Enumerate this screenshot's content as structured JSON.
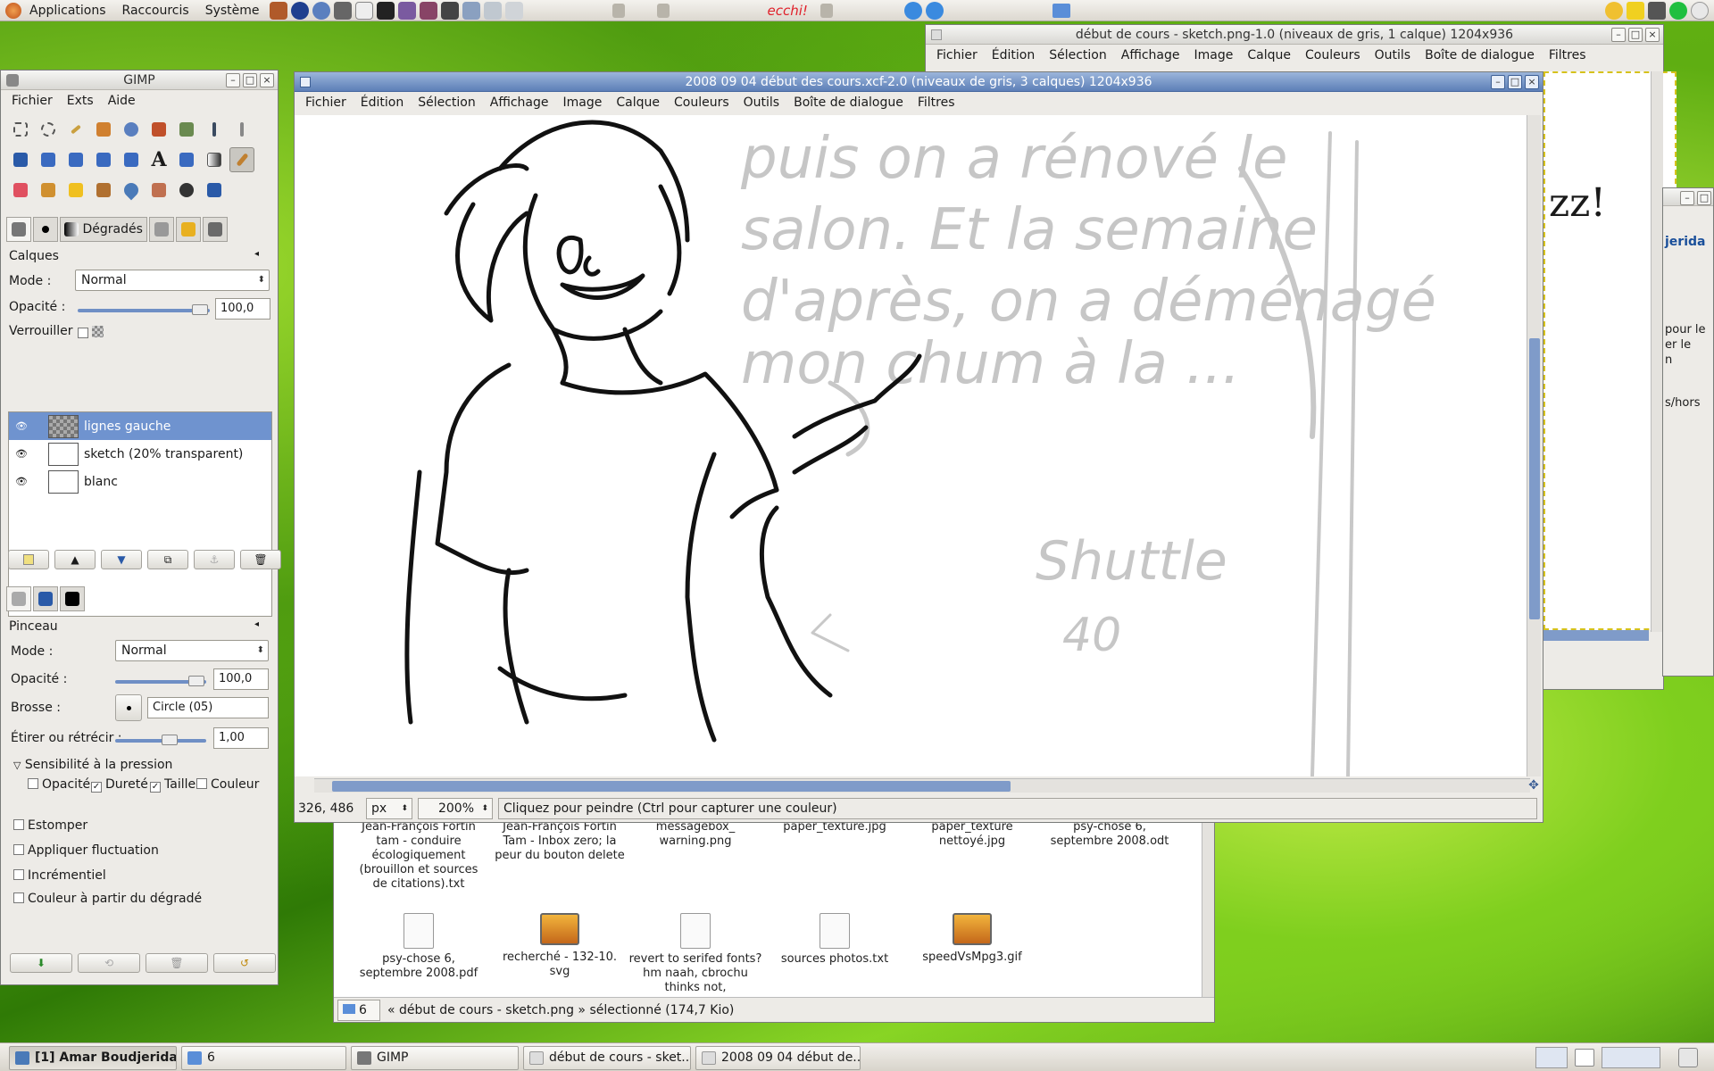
{
  "panel": {
    "menus": [
      "Applications",
      "Raccourcis",
      "Système"
    ],
    "ecchi_label": "ecchi!"
  },
  "colors": {
    "titlebar_active": "#5d7fb7",
    "layer_selected": "#6f93cf",
    "desktop_green": "#6cc018"
  },
  "sketch_window": {
    "title": "début de cours - sketch.png-1.0 (niveaux de gris, 1 calque) 1204x936",
    "menus": [
      "Fichier",
      "Édition",
      "Sélection",
      "Affichage",
      "Image",
      "Calque",
      "Couleurs",
      "Outils",
      "Boîte de dialogue",
      "Filtres"
    ],
    "partial_texts": [
      "jerida",
      "pour le",
      "er le",
      "n",
      "s/hors"
    ]
  },
  "toolbox": {
    "title": "GIMP",
    "menus": [
      "Fichier",
      "Exts",
      "Aide"
    ],
    "tabs": {
      "gradients": "Dégradés"
    },
    "layers": {
      "heading": "Calques",
      "mode_label": "Mode :",
      "mode_value": "Normal",
      "opacity_label": "Opacité :",
      "opacity_value": "100,0",
      "opacity_fraction": 1.0,
      "lock_label": "Verrouiller :",
      "items": [
        {
          "name": "lignes gauche",
          "selected": true
        },
        {
          "name": "sketch (20% transparent)",
          "selected": false
        },
        {
          "name": "blanc",
          "selected": false
        }
      ]
    },
    "brush_options": {
      "heading": "Pinceau",
      "mode_label": "Mode :",
      "mode_value": "Normal",
      "opacity_label": "Opacité :",
      "opacity_value": "100,0",
      "brush_label": "Brosse :",
      "brush_value": "Circle (05)",
      "scale_label": "Étirer ou rétrécir :",
      "scale_value": "1,00",
      "pressure_label": "Sensibilité à la pression",
      "pressure_opacity": "Opacité",
      "pressure_hardness": "Dureté",
      "pressure_size": "Taille",
      "pressure_color": "Couleur",
      "fade": "Estomper",
      "jitter": "Appliquer fluctuation",
      "incremental": "Incrémentiel",
      "gradient_color": "Couleur à partir du dégradé"
    }
  },
  "image_window": {
    "title": "2008 09 04 début des cours.xcf-2.0 (niveaux de gris, 3 calques) 1204x936",
    "menus": [
      "Fichier",
      "Édition",
      "Sélection",
      "Affichage",
      "Image",
      "Calque",
      "Couleurs",
      "Outils",
      "Boîte de dialogue",
      "Filtres"
    ],
    "status": {
      "coords": "326, 486",
      "unit": "px",
      "zoom": "200%",
      "message": "Cliquez pour peindre (Ctrl pour capturer une couleur)"
    },
    "sketch_text_lines": [
      "puis on a rénové le",
      "salon. Et la semaine",
      "d'après, on a déménagé",
      "mon chum à la ..."
    ],
    "sketch_note": "Shuttle",
    "sketch_note_2": "40"
  },
  "file_manager": {
    "files_row1": [
      "Jean-François Fortin tam - conduire écologiquement (brouillon et sources de citations).txt",
      "Jean-François Fortin Tam - Inbox zero; la peur du bouton delete",
      "messagebox_ warning.png",
      "paper_texture.jpg",
      "paper_texture nettoyé.jpg",
      "psy-chose 6, septembre 2008.odt"
    ],
    "files_row2": [
      "psy-chose 6, septembre 2008.pdf",
      "recherché - 132-10. svg",
      "revert to serifed fonts? hm naah, cbrochu thinks not,",
      "sources photos.txt",
      "speedVsMpg3.gif"
    ],
    "folder_count": "6",
    "status": "« début de cours - sketch.png » sélectionné (174,7 Kio)"
  },
  "taskbar": {
    "items": [
      "[1] Amar Boudjerida",
      "6",
      "GIMP",
      "début de cours - sket...",
      "2008 09 04 début de..."
    ]
  }
}
